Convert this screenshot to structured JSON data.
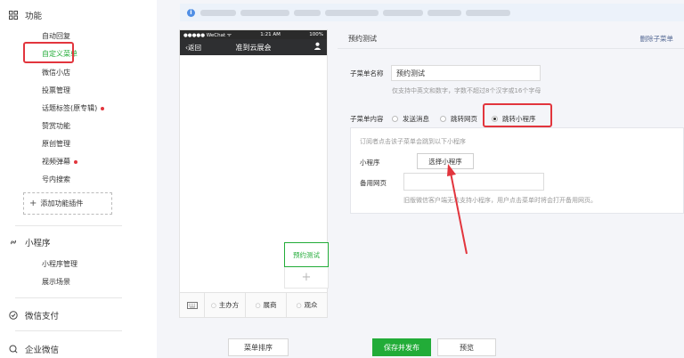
{
  "sidebar": {
    "sections": [
      {
        "title": "功能",
        "icon": "grid-icon"
      },
      {
        "title": "小程序",
        "icon": "link-icon"
      },
      {
        "title": "微信支付",
        "icon": "pay-icon"
      },
      {
        "title": "企业微信",
        "icon": "enterprise-icon"
      }
    ],
    "function_items": [
      {
        "label": "自动回复",
        "dot": false
      },
      {
        "label": "自定义菜单",
        "dot": false
      },
      {
        "label": "微信小店",
        "dot": false
      },
      {
        "label": "投票管理",
        "dot": false
      },
      {
        "label": "话题标签(原专辑)",
        "dot": true
      },
      {
        "label": "赞赏功能",
        "dot": false
      },
      {
        "label": "原创管理",
        "dot": false
      },
      {
        "label": "视频弹幕",
        "dot": true
      },
      {
        "label": "号内搜索",
        "dot": false
      }
    ],
    "add_plugin": "添加功能插件",
    "mini_items": [
      {
        "label": "小程序管理"
      },
      {
        "label": "展示场景"
      }
    ]
  },
  "phone": {
    "status_left": "●●●●● WeChat ᯤ",
    "status_time": "1:21 AM",
    "status_right": "100%",
    "back_label": "返回",
    "title": "准到云展会",
    "submenu_item": "预约测试",
    "add_symbol": "+",
    "menu": [
      "主办方",
      "展商",
      "观众"
    ]
  },
  "editor": {
    "submenu_name": "预约测试",
    "delete_label": "删除子菜单",
    "name_label": "子菜单名称",
    "name_value": "预约测试",
    "name_hint": "仅支持中英文和数字，字数不超过8个汉字或16个字母",
    "content_label": "子菜单内容",
    "options": [
      "发送消息",
      "跳转网页",
      "跳转小程序"
    ],
    "selected": "跳转小程序",
    "box_desc": "订阅者点击该子菜单会跳到以下小程序",
    "mini_label": "小程序",
    "choose_button": "选择小程序",
    "backup_label": "备用网页",
    "backup_hint": "旧版微信客户端无法支持小程序，用户点击菜单时将会打开备用网页。"
  },
  "footer": {
    "sort_button": "菜单排序",
    "publish_button": "保存并发布",
    "preview_button": "预览"
  },
  "colors": {
    "accent_green": "#22ac38",
    "highlight_red": "#e2353d",
    "link_blue": "#576b95"
  }
}
